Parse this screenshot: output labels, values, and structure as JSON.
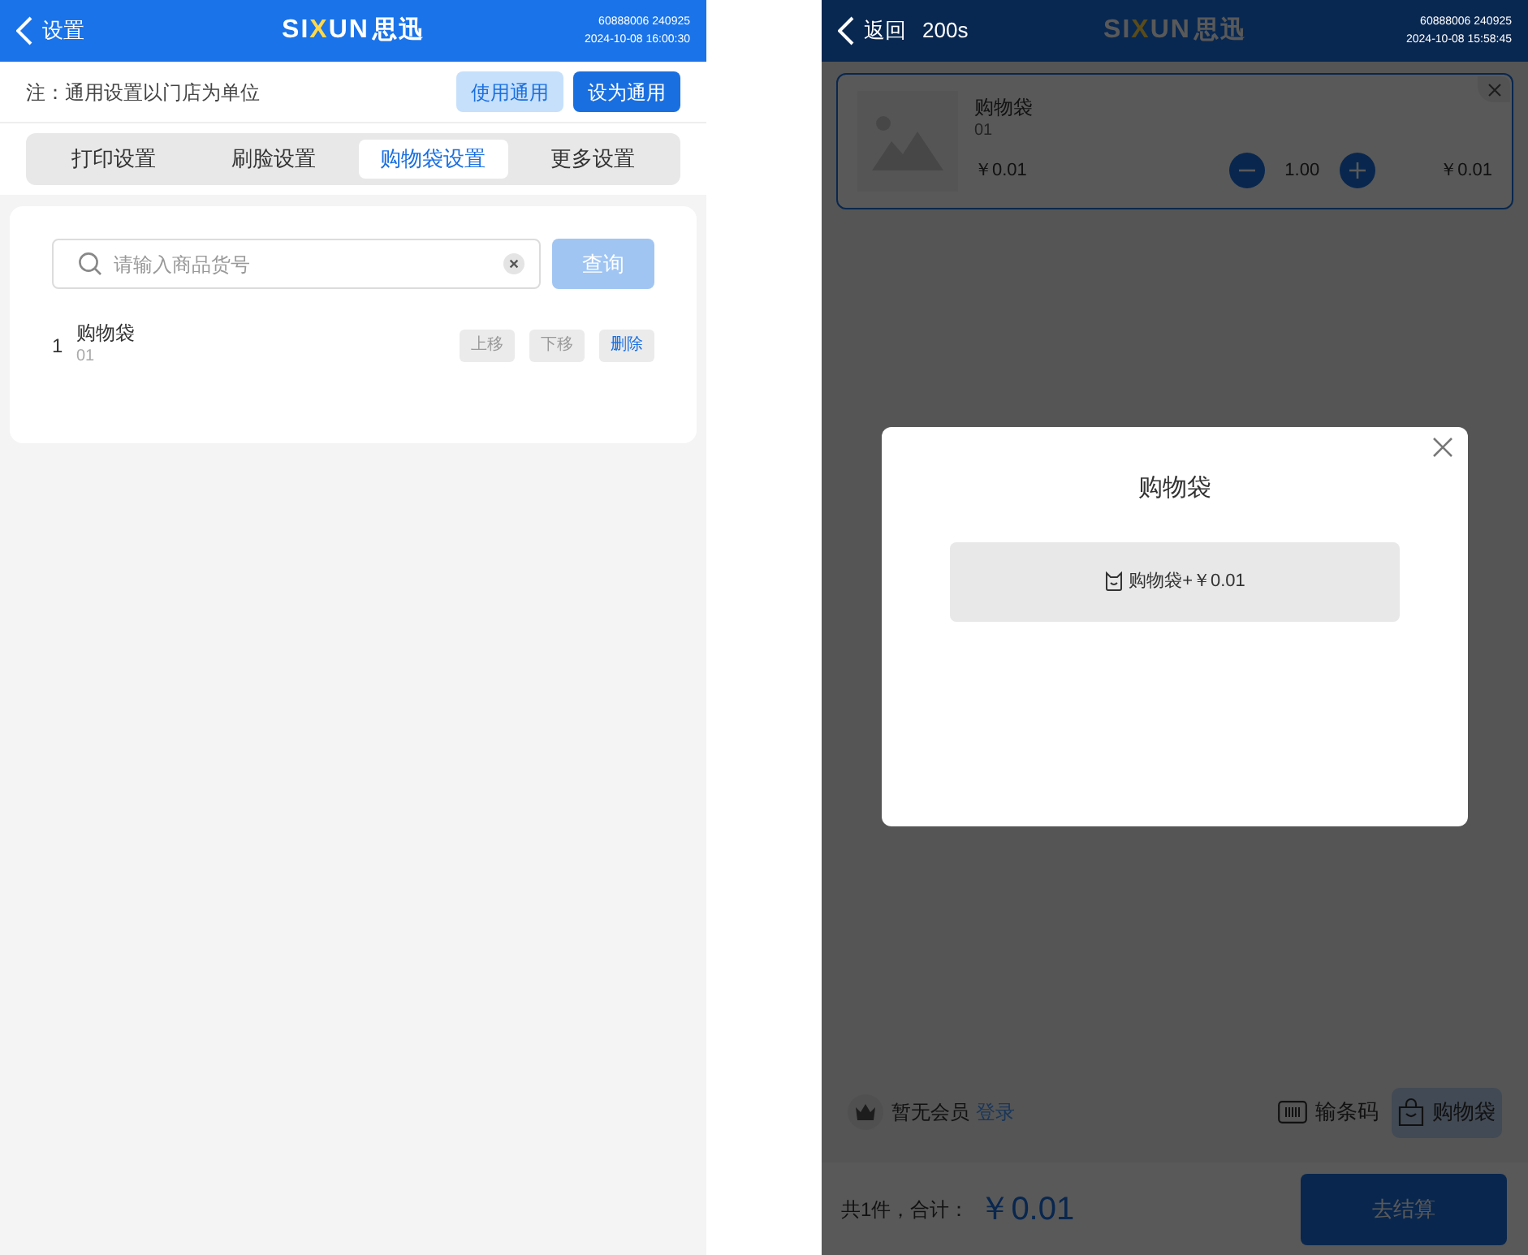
{
  "settings_screen": {
    "header": {
      "back_label": "设置",
      "logo": "SIXUN",
      "logo_cn": "思迅",
      "device_id": "60888006 240925",
      "datetime": "2024-10-08 16:00:30"
    },
    "note": "注：通用设置以门店为单位",
    "buttons": [
      {
        "label": "使用通用",
        "kind": "secondary"
      },
      {
        "label": "设为通用",
        "kind": "primary"
      }
    ],
    "tabs": [
      {
        "label": "打印设置",
        "selected": false
      },
      {
        "label": "刷脸设置",
        "selected": false
      },
      {
        "label": "购物袋设置",
        "selected": true
      },
      {
        "label": "更多设置",
        "selected": false
      }
    ],
    "search": {
      "placeholder": "请输入商品货号",
      "button": "查询"
    },
    "items": [
      {
        "index": "1",
        "name": "购物袋",
        "code": "01",
        "actions": [
          {
            "label": "上移",
            "disabled": true
          },
          {
            "label": "下移",
            "disabled": true
          },
          {
            "label": "删除",
            "disabled": false
          }
        ]
      }
    ]
  },
  "cart_screen": {
    "header": {
      "back_label": "返回",
      "countdown": "200s",
      "logo": "SIXUN",
      "logo_cn": "思迅",
      "device_id": "60888006 240925",
      "datetime": "2024-10-08 15:58:45"
    },
    "cart_item": {
      "name": "购物袋",
      "code": "01",
      "price": "￥0.01",
      "quantity": "1.00",
      "subtotal": "￥0.01"
    },
    "member": {
      "text": "暂无会员",
      "login": "登录"
    },
    "tools": [
      {
        "label": "输条码",
        "selected": false
      },
      {
        "label": "购物袋",
        "selected": true
      }
    ],
    "summary": {
      "count_label": "共1件，合计：",
      "total": "￥0.01"
    },
    "checkout_button": "去结算",
    "modal": {
      "title": "购物袋",
      "option": "购物袋+￥0.01"
    }
  }
}
